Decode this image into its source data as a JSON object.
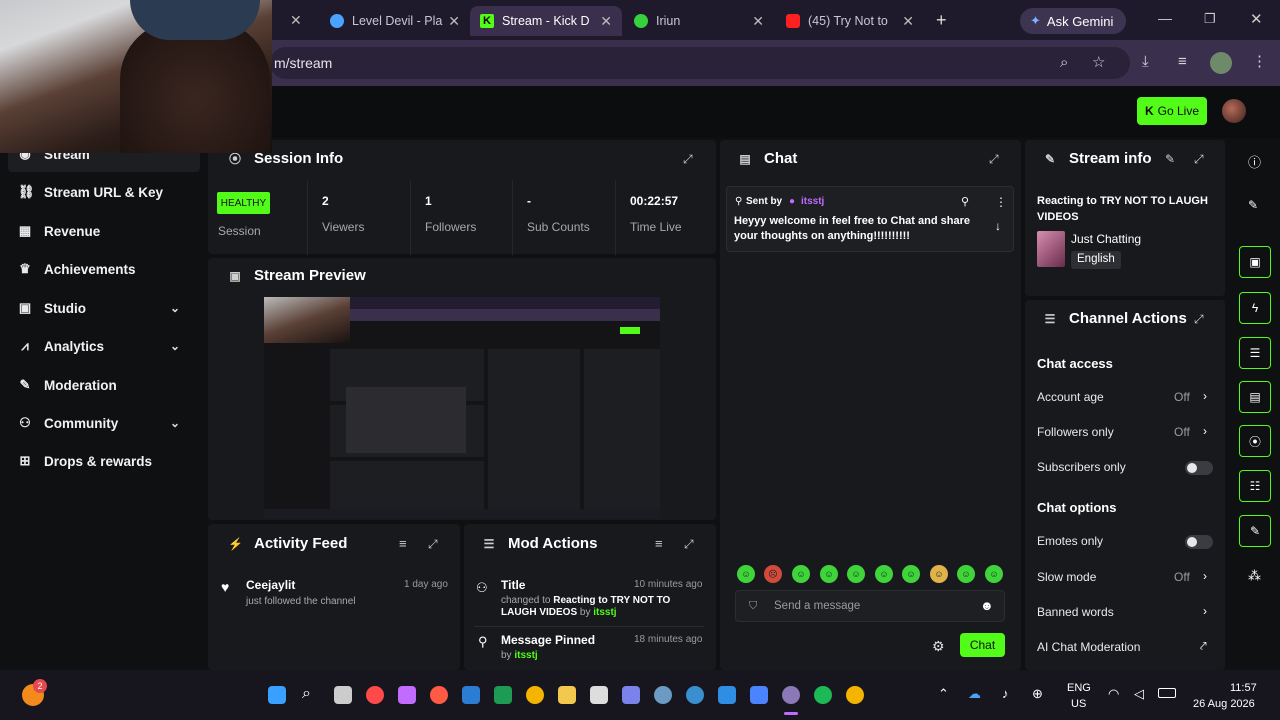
{
  "browser": {
    "tabs": [
      {
        "label": "Level Devil - Pla",
        "active": false
      },
      {
        "label": "Stream - Kick D",
        "active": true
      },
      {
        "label": "Iriun",
        "active": false
      },
      {
        "label": "(45) Try Not to",
        "active": false
      }
    ],
    "new_tab": "+",
    "gemini_label": "Ask Gemini",
    "url": "m/stream"
  },
  "topbar": {
    "go_live": "Go Live"
  },
  "sidebar": {
    "items": [
      {
        "label": "Stream"
      },
      {
        "label": "Stream URL & Key"
      },
      {
        "label": "Revenue"
      },
      {
        "label": "Achievements"
      },
      {
        "label": "Studio"
      },
      {
        "label": "Analytics"
      },
      {
        "label": "Moderation"
      },
      {
        "label": "Community"
      },
      {
        "label": "Drops & rewards"
      }
    ]
  },
  "session": {
    "title": "Session Info",
    "badge": "HEALTHY",
    "session_label": "Session",
    "stats": [
      {
        "value": "2",
        "label": "Viewers"
      },
      {
        "value": "1",
        "label": "Followers"
      },
      {
        "value": "-",
        "label": "Sub Counts"
      },
      {
        "value": "00:22:57",
        "label": "Time Live"
      }
    ]
  },
  "preview": {
    "title": "Stream Preview"
  },
  "activity": {
    "title": "Activity Feed",
    "items": [
      {
        "name": "Ceejaylit",
        "text": "just followed the channel",
        "time": "1 day ago"
      }
    ]
  },
  "mod": {
    "title": "Mod Actions",
    "items": [
      {
        "title": "Title",
        "time": "10 minutes ago",
        "prefix": "changed to ",
        "bold": "Reacting to TRY NOT TO LAUGH VIDEOS",
        "by": " by ",
        "user": "itsstj"
      },
      {
        "title": "Message Pinned",
        "time": "18 minutes ago",
        "by": "by ",
        "user": "itsstj"
      }
    ]
  },
  "chat": {
    "title": "Chat",
    "pinned_sent_by": "Sent by",
    "pinned_user": "itsstj",
    "pinned_message": "Heyyy welcome in feel free to Chat and share your thoughts on anything!!!!!!!!!!",
    "input_placeholder": "Send a message",
    "send_button": "Chat"
  },
  "stream_info": {
    "title": "Stream info",
    "stream_title": "Reacting to TRY NOT TO LAUGH VIDEOS",
    "category": "Just Chatting",
    "language": "English"
  },
  "channel_actions": {
    "title": "Channel Actions",
    "chat_access": "Chat access",
    "account_age": {
      "label": "Account age",
      "value": "Off"
    },
    "followers_only": {
      "label": "Followers only",
      "value": "Off"
    },
    "subscribers_only": {
      "label": "Subscribers only"
    },
    "chat_options": "Chat options",
    "emotes_only": {
      "label": "Emotes only"
    },
    "slow_mode": {
      "label": "Slow mode",
      "value": "Off"
    },
    "banned_words": {
      "label": "Banned words"
    },
    "ai_moderation": {
      "label": "AI Chat Moderation"
    }
  },
  "taskbar": {
    "notification_count": "2",
    "lang_top": "ENG",
    "lang_bottom": "US",
    "time": "11:57",
    "date": "26 Aug 2026"
  },
  "colors": {
    "kick_green": "#53fc18",
    "panel": "#18191c",
    "chrome": "#3a2f4d"
  }
}
